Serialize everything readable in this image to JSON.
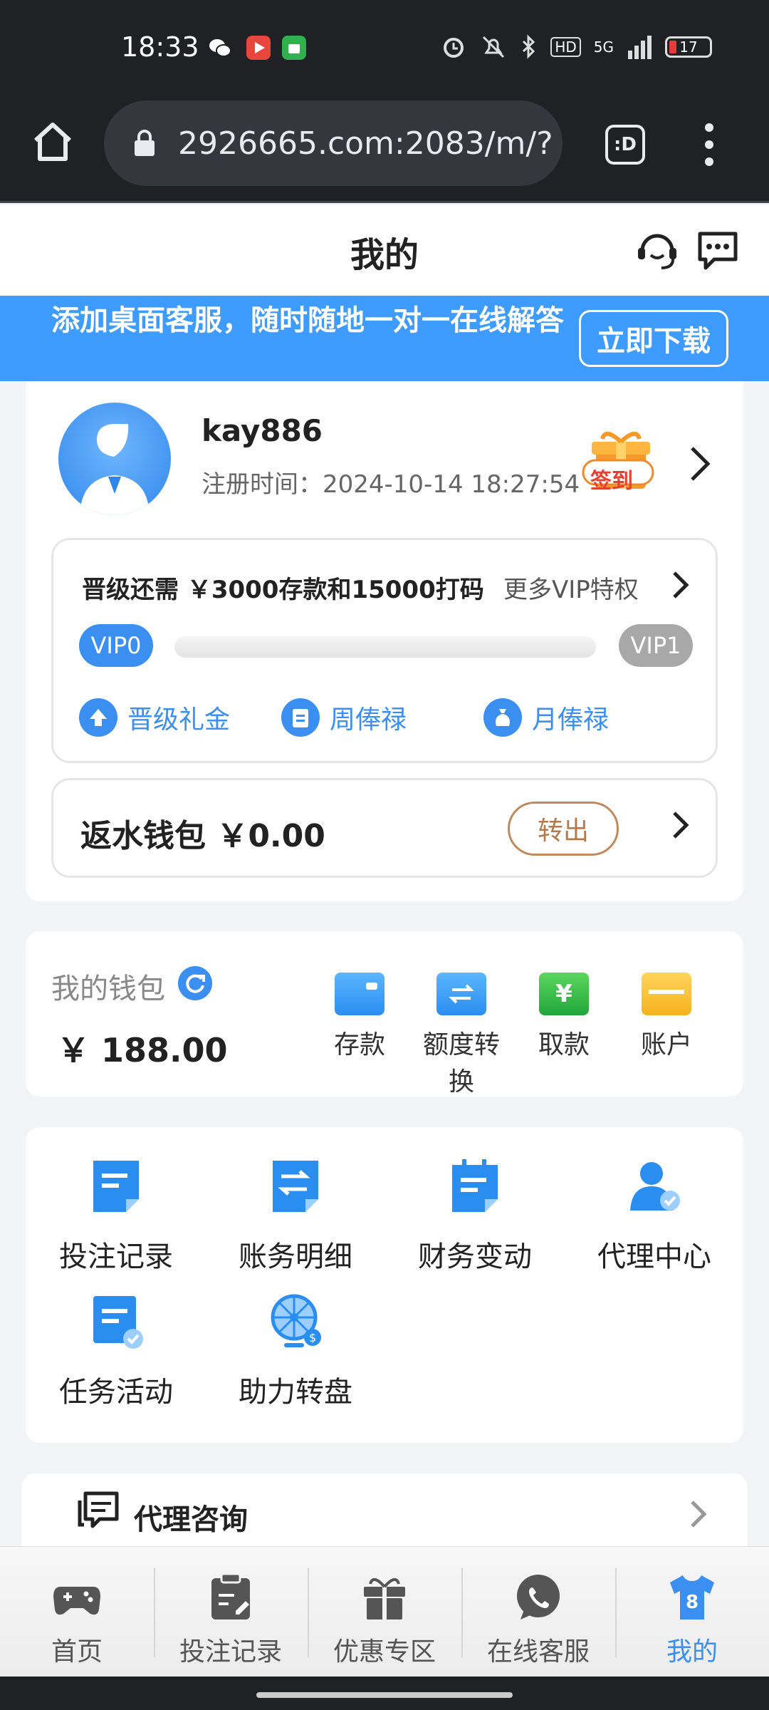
{
  "status_bar": {
    "time": "18:33",
    "network": "5G",
    "hd": "HD",
    "battery": "17"
  },
  "browser": {
    "url": "2926665.com:2083/m/?",
    "tabs_label": ":D"
  },
  "header": {
    "title": "我的"
  },
  "banner": {
    "text": "添加桌面客服，随时随地一对一在线解答",
    "button": "立即下载"
  },
  "profile": {
    "username": "kay886",
    "reg_time": "注册时间：2024-10-14 18:27:54",
    "signin_label": "签到"
  },
  "vip": {
    "need_text": "晋级还需 ￥3000存款和15000打码",
    "more_label": "更多VIP特权",
    "current": "VIP0",
    "next": "VIP1",
    "progress": 0,
    "perks": [
      "晋级礼金",
      "周俸禄",
      "月俸禄"
    ]
  },
  "rebate": {
    "label": "返水钱包 ￥0.00",
    "button": "转出"
  },
  "wallet": {
    "label": "我的钱包",
    "amount": "￥ 188.00",
    "actions": [
      "存款",
      "额度转换",
      "取款",
      "账户"
    ]
  },
  "grid": {
    "items": [
      "投注记录",
      "账务明细",
      "财务变动",
      "代理中心",
      "任务活动",
      "助力转盘"
    ]
  },
  "agent": {
    "label": "代理咨询"
  },
  "nav": {
    "items": [
      "首页",
      "投注记录",
      "优惠专区",
      "在线客服",
      "我的"
    ],
    "active_color": "#3a8ff0"
  },
  "colors": {
    "accent": "#3a8ff0",
    "banner": "#3e9bff",
    "rebate_button": "#b57a4b"
  }
}
